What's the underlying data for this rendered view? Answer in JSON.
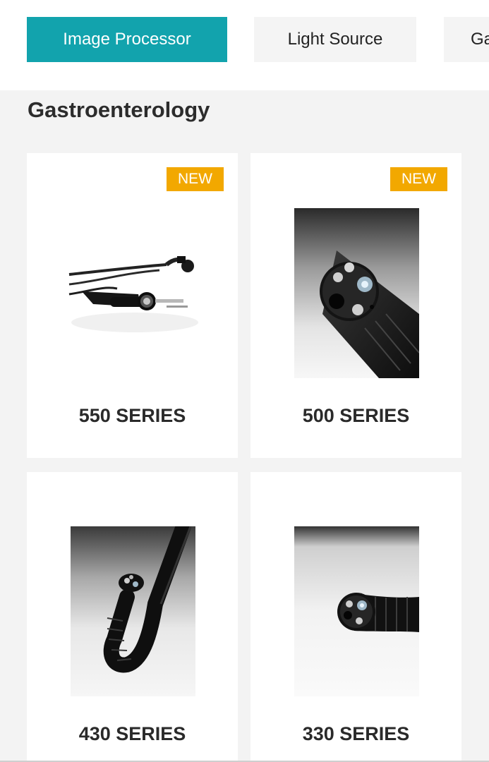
{
  "tabs": [
    {
      "label": "Image Processor",
      "active": true
    },
    {
      "label": "Light Source",
      "active": false
    },
    {
      "label": "Ga",
      "active": false
    }
  ],
  "section": {
    "title": "Gastroenterology"
  },
  "products": [
    {
      "name": "550 SERIES",
      "badge": "NEW",
      "image": "scope-with-connector-icon"
    },
    {
      "name": "500 SERIES",
      "badge": "NEW",
      "image": "scope-tip-closeup-icon"
    },
    {
      "name": "430 SERIES",
      "badge": "",
      "image": "bent-scope-icon"
    },
    {
      "name": "330 SERIES",
      "badge": "",
      "image": "scope-tip-icon"
    }
  ],
  "colors": {
    "accent": "#12a3ad",
    "badge": "#f2a800",
    "background": "#f3f3f3"
  }
}
